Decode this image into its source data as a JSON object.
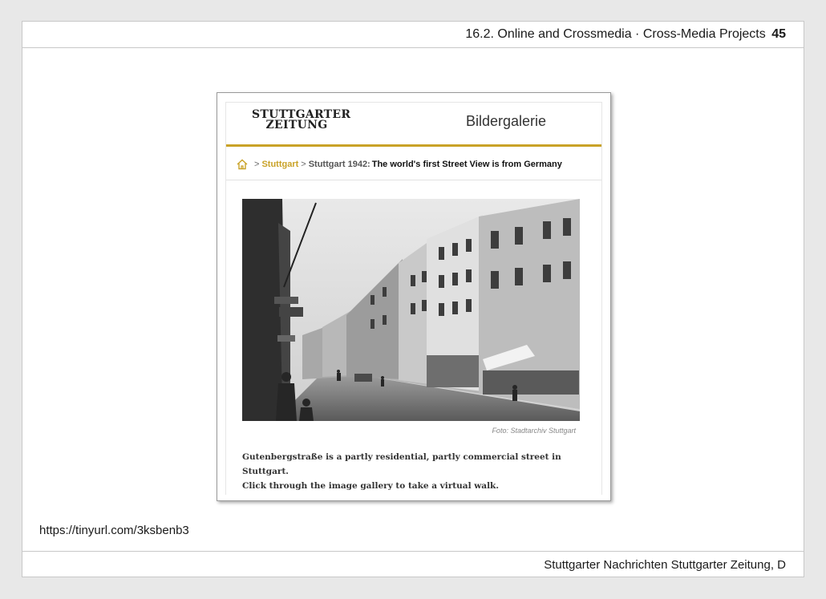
{
  "header": {
    "title": "16.2. Online and Crossmedia · Cross-Media Projects",
    "page_number": "45"
  },
  "screenshot": {
    "logo_line1": "STUTTGARTER",
    "logo_line2": "ZEITUNG",
    "section_title": "Bildergalerie",
    "breadcrumb": {
      "home_icon": "home-icon",
      "sep": ">",
      "link": "Stuttgart",
      "current": "Stuttgart 1942:",
      "headline": "The world's first Street View is from Germany"
    },
    "photo_credit": "Foto: Stadtarchiv Stuttgart",
    "caption_line1": "Gutenbergstraße is a partly residential, partly commercial street in Stuttgart.",
    "caption_line2": "Click through the image gallery to take a virtual walk.",
    "accent_color": "#c9a227"
  },
  "link": "https://tinyurl.com/3ksbenb3",
  "footer": {
    "source": "Stuttgarter Nachrichten Stuttgarter Zeitung, D"
  }
}
